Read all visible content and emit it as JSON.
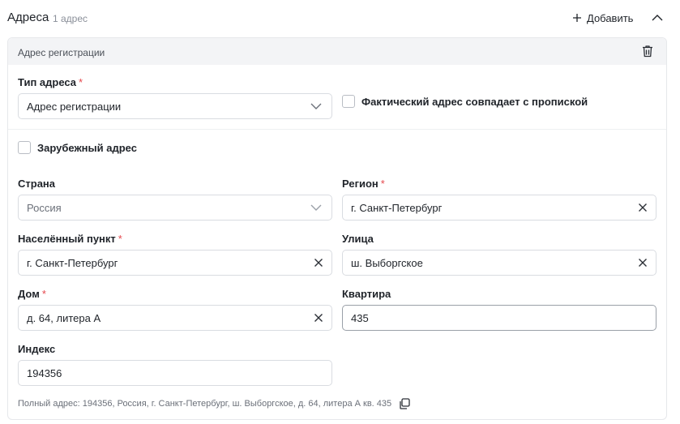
{
  "section": {
    "title": "Адреса",
    "count": "1 адрес",
    "add_label": "Добавить"
  },
  "card": {
    "title": "Адрес регистрации"
  },
  "form": {
    "address_type": {
      "label": "Тип адреса",
      "value": "Адрес регистрации"
    },
    "actual_same": {
      "label": "Фактический адрес совпадает с пропиской",
      "checked": false
    },
    "foreign": {
      "label": "Зарубежный адрес",
      "checked": false
    },
    "country": {
      "label": "Страна",
      "value": "Россия"
    },
    "region": {
      "label": "Регион",
      "value": "г. Санкт-Петербург"
    },
    "locality": {
      "label": "Населённый пункт",
      "value": "г. Санкт-Петербург"
    },
    "street": {
      "label": "Улица",
      "value": "ш. Выборгское"
    },
    "house": {
      "label": "Дом",
      "value": "д. 64, литера А"
    },
    "apartment": {
      "label": "Квартира",
      "value": "435"
    },
    "index": {
      "label": "Индекс",
      "value": "194356"
    },
    "required_mark": "*"
  },
  "full_address": "Полный адрес: 194356, Россия, г. Санкт-Петербург, ш. Выборгское, д. 64, литера А кв. 435",
  "colors": {
    "required": "#e5484d",
    "header_bg": "#f3f4f6",
    "border": "#d9dce1"
  },
  "icons": [
    "plus-icon",
    "chevron-up-icon",
    "trash-icon",
    "chevron-down-icon",
    "clear-icon",
    "copy-icon"
  ]
}
